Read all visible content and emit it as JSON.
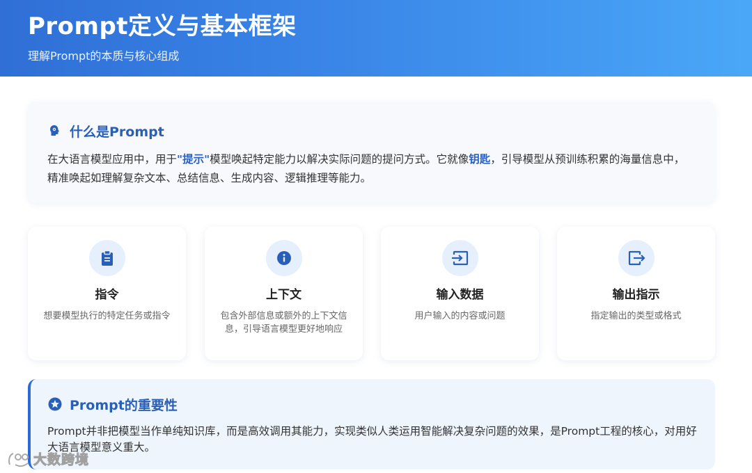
{
  "header": {
    "title": "Prompt定义与基本框架",
    "subtitle": "理解Prompt的本质与核心组成"
  },
  "what": {
    "title": "什么是Prompt",
    "icon": "head-brain-icon",
    "text_1": "在大语言模型应用中，用于",
    "highlight_1": "\"提示\"",
    "text_2": "模型唤起特定能力以解决实际问题的提问方式。它就像",
    "highlight_2": "钥匙",
    "text_3": "，引导模型从预训练积累的海量信息中，精准唤起如理解复杂文本、总结信息、生成内容、逻辑推理等能力。"
  },
  "components": [
    {
      "icon": "clipboard-icon",
      "title": "指令",
      "desc": "想要模型执行的特定任务或指令"
    },
    {
      "icon": "info-icon",
      "title": "上下文",
      "desc": "包含外部信息或额外的上下文信息，引导语言模型更好地响应"
    },
    {
      "icon": "input-icon",
      "title": "输入数据",
      "desc": "用户输入的内容或问题"
    },
    {
      "icon": "output-icon",
      "title": "输出指示",
      "desc": "指定输出的类型或格式"
    }
  ],
  "importance": {
    "title": "Prompt的重要性",
    "icon": "star-icon",
    "text": "Prompt并非把模型当作单纯知识库，而是高效调用其能力，实现类似人类运用智能解决复杂问题的效果，是Prompt工程的核心，对用好大语言模型意义重大。"
  },
  "watermark": {
    "text": "大数跨境"
  },
  "colors": {
    "accent": "#2a5fb8",
    "header_start": "#2f6fd6",
    "header_end": "#4aa7f7",
    "icon_bg": "#e6f0fc"
  }
}
